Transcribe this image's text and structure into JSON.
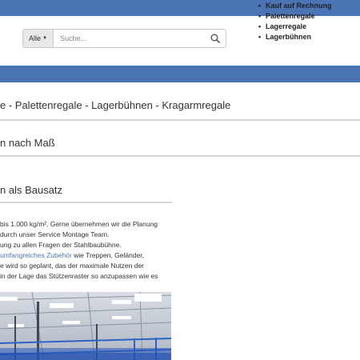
{
  "header": {
    "search": {
      "category_label": "Alle",
      "placeholder": "Suche..."
    },
    "usp_items": [
      "Kauf auf Rechnung",
      "Palettenregale",
      "Lagerregale",
      "Lagerbühnen"
    ]
  },
  "main": {
    "category_heading": "e - Palettenregale - Lagerbühnen - Kragarmregale",
    "section1_title": "n nach Maß",
    "section2_title": "n als Bausatz",
    "paragraph": {
      "line1": "bis 1.000 kg/m². Gerne übernehmen wir die Planung",
      "line2": "durch unser Service Montage Team.",
      "line3": "ung zu allen Fragen der Stahlbaubühne.",
      "line4_link": "umfangreiches Zubehör",
      "line4_rest": " wie Treppen, Geländer,",
      "line5": "e wird so geplant, das der maximale Nutzen der",
      "line6": "in der Lage das Stützenraster so anzupassen wie es"
    }
  },
  "colors": {
    "brand_blue": "#4a74b4",
    "divider": "#d6d6d6"
  },
  "icons": {
    "search": "search-icon",
    "caret": "chevron-down-icon",
    "bullet": "bullet-icon"
  }
}
